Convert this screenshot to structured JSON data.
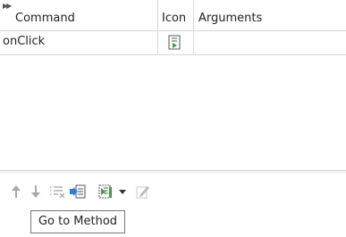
{
  "table": {
    "columns": [
      {
        "label": "Command"
      },
      {
        "label": "Icon"
      },
      {
        "label": "Arguments"
      }
    ],
    "rows": [
      {
        "command": "onClick",
        "icon": "method-icon",
        "arguments": ""
      }
    ]
  },
  "toolbar": {
    "buttons": [
      {
        "name": "move-up",
        "icon": "arrow-up-icon"
      },
      {
        "name": "move-down",
        "icon": "arrow-down-icon"
      },
      {
        "name": "clear-table",
        "icon": "clear-list-icon"
      },
      {
        "name": "go-to-method",
        "icon": "go-to-method-icon"
      },
      {
        "name": "add-method",
        "icon": "add-method-icon"
      },
      {
        "name": "add-method-dropdown",
        "icon": "dropdown-triangle-icon"
      },
      {
        "name": "edit",
        "icon": "edit-icon"
      }
    ]
  },
  "tooltip": {
    "text": "Go to Method"
  },
  "colors": {
    "accent_blue": "#2a7fd4",
    "method_green": "#3aa03a",
    "disabled_gray": "#a8a8a8",
    "border": "#d6d6d6"
  }
}
